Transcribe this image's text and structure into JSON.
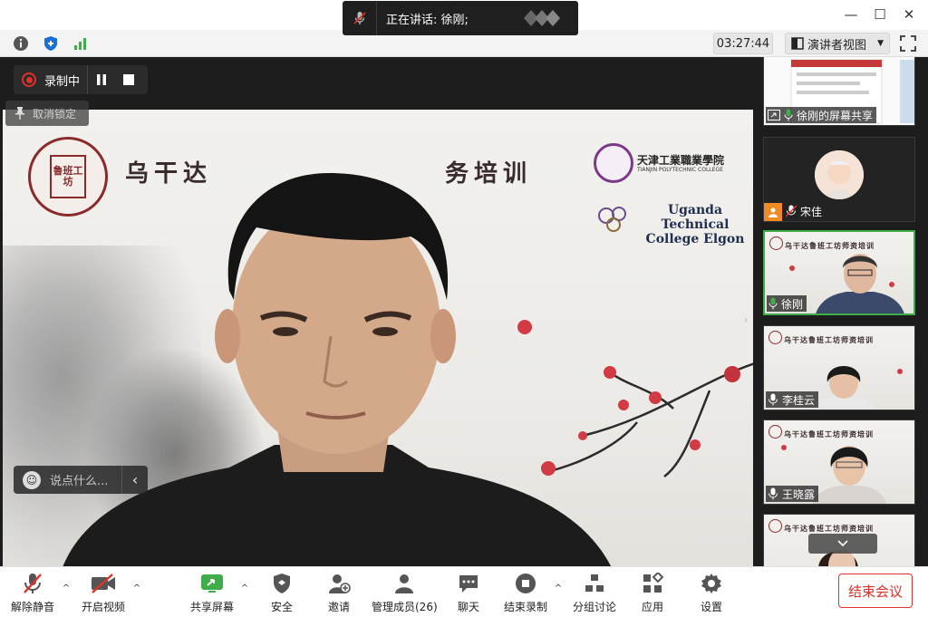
{
  "speaker_banner": {
    "text": "正在讲话: 徐刚;"
  },
  "window_controls": {
    "minimize": "—",
    "maximize": "☐",
    "close": "✕"
  },
  "toolbar": {
    "timer": "03:27:44",
    "view_label": "演讲者视图",
    "icons": [
      "info-icon",
      "shield-icon",
      "signal-icon",
      "fullscreen-icon"
    ]
  },
  "recording": {
    "label": "录制中"
  },
  "unpin": {
    "label": "取消锁定"
  },
  "chat_input": {
    "placeholder": "说点什么..."
  },
  "banner": {
    "title_left": "乌干达",
    "title_right": "务培训",
    "seal_text": "鲁班工坊",
    "tjp_name": "天津工業職業學院",
    "tjp_sub": "TIANJIN POLYTECHNIC COLLEGE",
    "utc_name_line1": "Uganda Technical",
    "utc_name_line2": "College Elgon"
  },
  "participants": [
    {
      "name": "徐刚的屏幕共享",
      "type": "screen-share"
    },
    {
      "name": "宋佳",
      "type": "avatar",
      "host": true
    },
    {
      "name": "徐刚",
      "type": "video",
      "active": true
    },
    {
      "name": "李桂云",
      "type": "video"
    },
    {
      "name": "王晓露",
      "type": "video"
    },
    {
      "name": "",
      "type": "video"
    }
  ],
  "bottom_bar": {
    "unmute": "解除静音",
    "start_video": "开启视频",
    "share_screen": "共享屏幕",
    "security": "安全",
    "invite": "邀请",
    "participants": "管理成员(26)",
    "chat": "聊天",
    "stop_recording": "结束录制",
    "breakout": "分组讨论",
    "apps": "应用",
    "settings": "设置",
    "end_meeting": "结束会议"
  },
  "colors": {
    "accent_green": "#3fae4a",
    "danger_red": "#e0302a",
    "host_orange": "#f08a24",
    "blue": "#1a6fd8"
  }
}
